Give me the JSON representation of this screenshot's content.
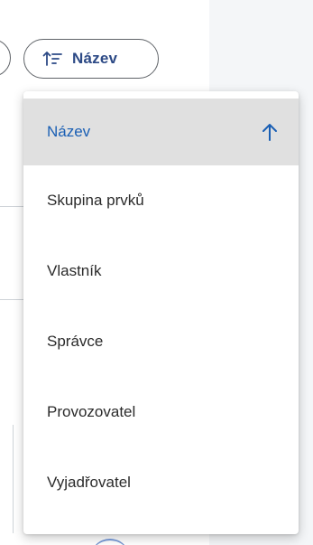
{
  "sort_chip": {
    "label": "Název",
    "icon": "sort-ascending-icon"
  },
  "sort_menu": {
    "items": [
      {
        "label": "Název",
        "active": true,
        "icon": "arrow-up-icon"
      },
      {
        "label": "Skupina prvků",
        "active": false
      },
      {
        "label": "Vlastník",
        "active": false
      },
      {
        "label": "Správce",
        "active": false
      },
      {
        "label": "Provozovatel",
        "active": false
      },
      {
        "label": "Vyjadřovatel",
        "active": false
      }
    ]
  },
  "colors": {
    "accent": "#1a5fb4",
    "chip_text": "#2d4a86",
    "active_bg": "#e0e0e0"
  }
}
